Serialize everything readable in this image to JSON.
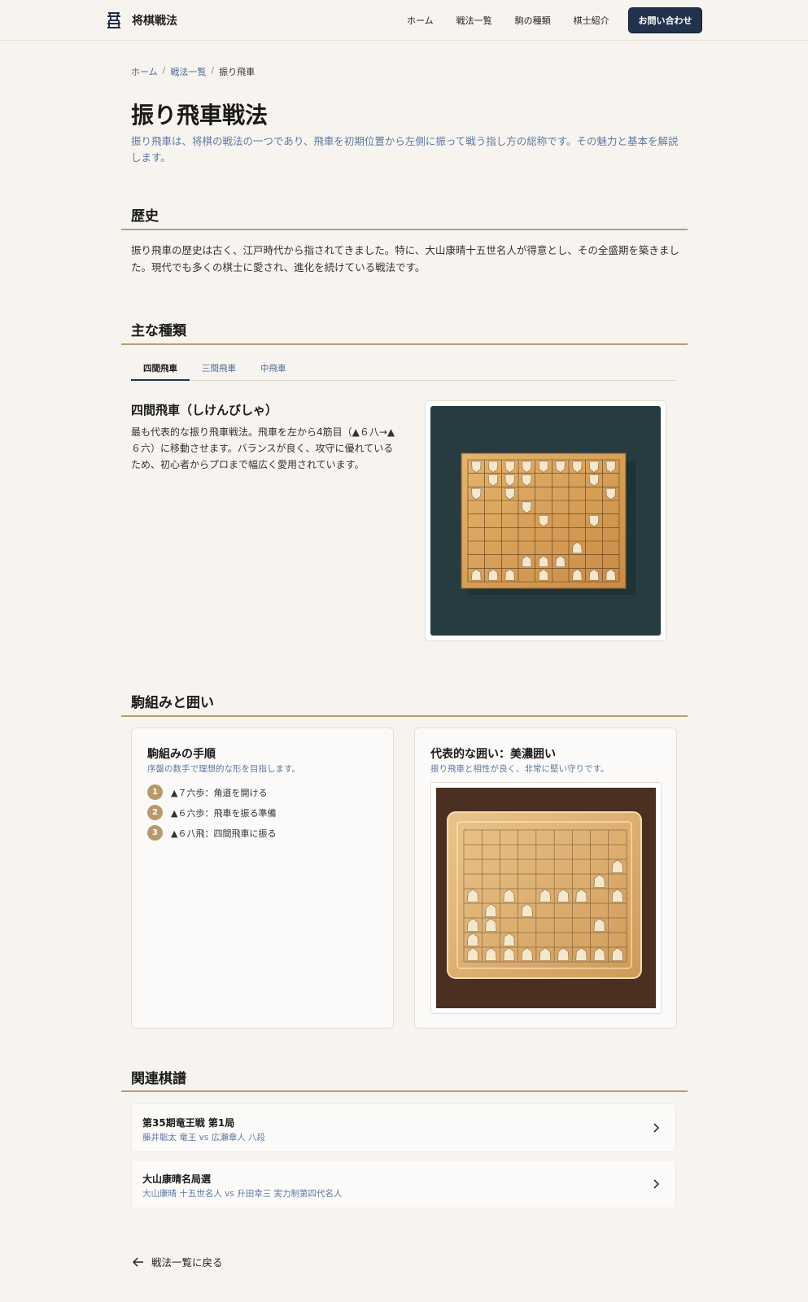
{
  "header": {
    "site_name": "将棋戦法",
    "nav": [
      "ホーム",
      "戦法一覧",
      "駒の種類",
      "棋士紹介"
    ],
    "contact_label": "お問い合わせ"
  },
  "breadcrumb": [
    "ホーム",
    "戦法一覧",
    "振り飛車"
  ],
  "page": {
    "title": "振り飛車戦法",
    "lead": "振り飛車は、将棋の戦法の一つであり、飛車を初期位置から左側に振って戦う指し方の総称です。その魅力と基本を解説します。"
  },
  "history": {
    "title": "歴史",
    "text": "振り飛車の歴史は古く、江戸時代から指されてきました。特に、大山康晴十五世名人が得意とし、その全盛期を築きました。現代でも多くの棋士に愛され、進化を続けている戦法です。"
  },
  "types": {
    "title": "主な種類",
    "tabs": [
      "四間飛車",
      "三間飛車",
      "中飛車"
    ],
    "active_tab": "四間飛車",
    "variant_title": "四間飛車（しけんびしゃ）",
    "variant_desc": "最も代表的な振り飛車戦法。飛車を左から4筋目（▲６八→▲６六）に移動させます。バランスが良く、攻守に優れているため、初心者からプロまで幅広く愛用されています。"
  },
  "formation": {
    "title": "駒組みと囲い",
    "steps_card": {
      "title": "駒組みの手順",
      "subtitle": "序盤の数手で理想的な形を目指します。",
      "steps": [
        {
          "num": "1",
          "text": "▲７六歩：角道を開ける"
        },
        {
          "num": "2",
          "text": "▲６六歩：飛車を振る準備"
        },
        {
          "num": "3",
          "text": "▲６八飛：四間飛車に振る"
        }
      ]
    },
    "castle_card": {
      "title": "代表的な囲い：美濃囲い",
      "subtitle": "振り飛車と相性が良く、非常に堅い守りです。"
    }
  },
  "related": {
    "title": "関連棋譜",
    "games": [
      {
        "title": "第35期竜王戦 第1局",
        "players": "藤井聡太 竜王 vs 広瀬章人 八段"
      },
      {
        "title": "大山康晴名局選",
        "players": "大山康晴 十五世名人 vs 升田幸三 実力制第四代名人"
      }
    ]
  },
  "back_label": "戦法一覧に戻る",
  "colors": {
    "accent_navy": "#22314c",
    "rule_gold": "#b89c70",
    "link_blue": "#4a6a94",
    "step_badge": "#b8996b"
  }
}
